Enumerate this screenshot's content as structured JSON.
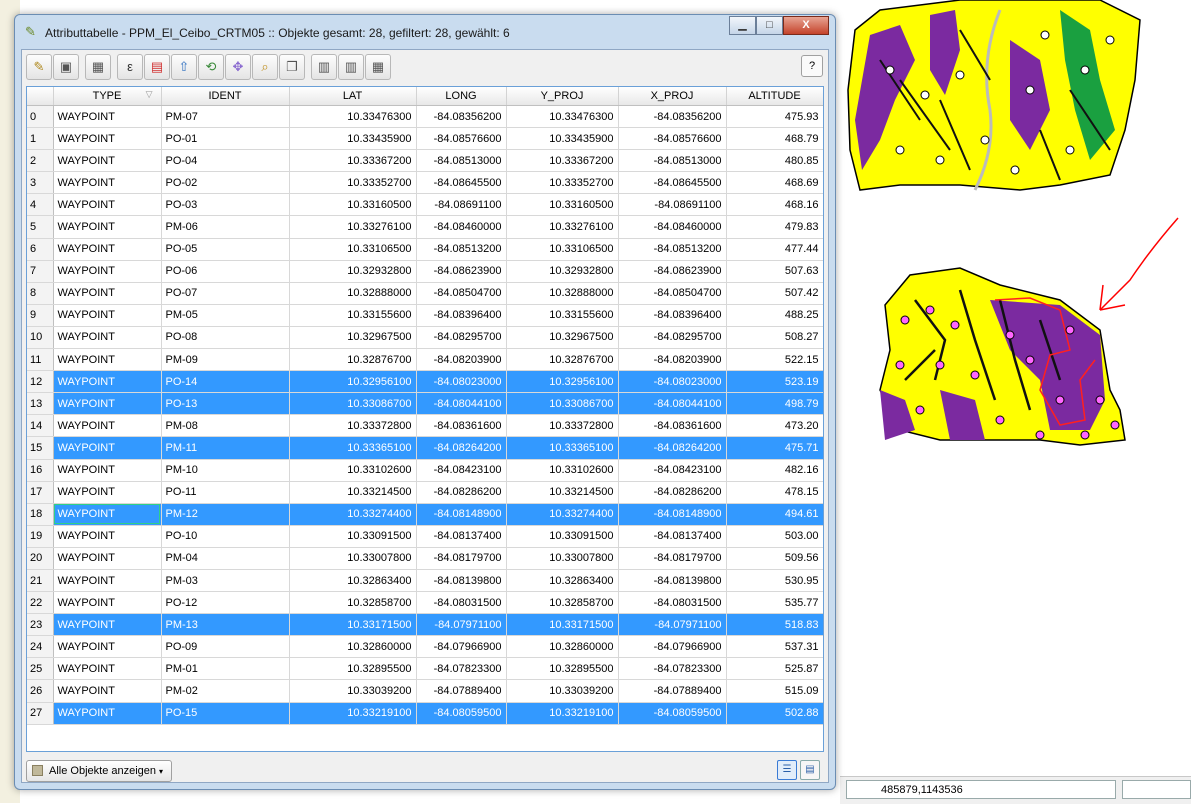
{
  "window": {
    "title": "Attributtabelle - PPM_El_Ceibo_CRTM05 :: Objekte gesamt: 28, gefiltert: 28, gewählt: 6",
    "minimize": "▁",
    "maximize": "□",
    "close": "X"
  },
  "toolbar": {
    "help_label": "?",
    "icons": [
      "pencil-icon",
      "save-icon",
      "delete-icon",
      "expression-select-icon",
      "deselect-icon",
      "move-to-top-icon",
      "invert-selection-icon",
      "pan-to-selection-icon",
      "zoom-to-selection-icon",
      "copy-icon",
      "new-column-icon",
      "delete-column-icon",
      "field-calculator-icon"
    ]
  },
  "table": {
    "columns": [
      "TYPE",
      "IDENT",
      "LAT",
      "LONG",
      "Y_PROJ",
      "X_PROJ",
      "ALTITUDE"
    ],
    "selected_rows": [
      12,
      13,
      15,
      18,
      23,
      27
    ],
    "rows": [
      [
        "0",
        "WAYPOINT",
        "PM-07",
        "10.33476300",
        "-84.08356200",
        "10.33476300",
        "-84.08356200",
        "475.93"
      ],
      [
        "1",
        "WAYPOINT",
        "PO-01",
        "10.33435900",
        "-84.08576600",
        "10.33435900",
        "-84.08576600",
        "468.79"
      ],
      [
        "2",
        "WAYPOINT",
        "PO-04",
        "10.33367200",
        "-84.08513000",
        "10.33367200",
        "-84.08513000",
        "480.85"
      ],
      [
        "3",
        "WAYPOINT",
        "PO-02",
        "10.33352700",
        "-84.08645500",
        "10.33352700",
        "-84.08645500",
        "468.69"
      ],
      [
        "4",
        "WAYPOINT",
        "PO-03",
        "10.33160500",
        "-84.08691100",
        "10.33160500",
        "-84.08691100",
        "468.16"
      ],
      [
        "5",
        "WAYPOINT",
        "PM-06",
        "10.33276100",
        "-84.08460000",
        "10.33276100",
        "-84.08460000",
        "479.83"
      ],
      [
        "6",
        "WAYPOINT",
        "PO-05",
        "10.33106500",
        "-84.08513200",
        "10.33106500",
        "-84.08513200",
        "477.44"
      ],
      [
        "7",
        "WAYPOINT",
        "PO-06",
        "10.32932800",
        "-84.08623900",
        "10.32932800",
        "-84.08623900",
        "507.63"
      ],
      [
        "8",
        "WAYPOINT",
        "PO-07",
        "10.32888000",
        "-84.08504700",
        "10.32888000",
        "-84.08504700",
        "507.42"
      ],
      [
        "9",
        "WAYPOINT",
        "PM-05",
        "10.33155600",
        "-84.08396400",
        "10.33155600",
        "-84.08396400",
        "488.25"
      ],
      [
        "10",
        "WAYPOINT",
        "PO-08",
        "10.32967500",
        "-84.08295700",
        "10.32967500",
        "-84.08295700",
        "508.27"
      ],
      [
        "11",
        "WAYPOINT",
        "PM-09",
        "10.32876700",
        "-84.08203900",
        "10.32876700",
        "-84.08203900",
        "522.15"
      ],
      [
        "12",
        "WAYPOINT",
        "PO-14",
        "10.32956100",
        "-84.08023000",
        "10.32956100",
        "-84.08023000",
        "523.19"
      ],
      [
        "13",
        "WAYPOINT",
        "PO-13",
        "10.33086700",
        "-84.08044100",
        "10.33086700",
        "-84.08044100",
        "498.79"
      ],
      [
        "14",
        "WAYPOINT",
        "PM-08",
        "10.33372800",
        "-84.08361600",
        "10.33372800",
        "-84.08361600",
        "473.20"
      ],
      [
        "15",
        "WAYPOINT",
        "PM-11",
        "10.33365100",
        "-84.08264200",
        "10.33365100",
        "-84.08264200",
        "475.71"
      ],
      [
        "16",
        "WAYPOINT",
        "PM-10",
        "10.33102600",
        "-84.08423100",
        "10.33102600",
        "-84.08423100",
        "482.16"
      ],
      [
        "17",
        "WAYPOINT",
        "PO-11",
        "10.33214500",
        "-84.08286200",
        "10.33214500",
        "-84.08286200",
        "478.15"
      ],
      [
        "18",
        "WAYPOINT",
        "PM-12",
        "10.33274400",
        "-84.08148900",
        "10.33274400",
        "-84.08148900",
        "494.61"
      ],
      [
        "19",
        "WAYPOINT",
        "PO-10",
        "10.33091500",
        "-84.08137400",
        "10.33091500",
        "-84.08137400",
        "503.00"
      ],
      [
        "20",
        "WAYPOINT",
        "PM-04",
        "10.33007800",
        "-84.08179700",
        "10.33007800",
        "-84.08179700",
        "509.56"
      ],
      [
        "21",
        "WAYPOINT",
        "PM-03",
        "10.32863400",
        "-84.08139800",
        "10.32863400",
        "-84.08139800",
        "530.95"
      ],
      [
        "22",
        "WAYPOINT",
        "PO-12",
        "10.32858700",
        "-84.08031500",
        "10.32858700",
        "-84.08031500",
        "535.77"
      ],
      [
        "23",
        "WAYPOINT",
        "PM-13",
        "10.33171500",
        "-84.07971100",
        "10.33171500",
        "-84.07971100",
        "518.83"
      ],
      [
        "24",
        "WAYPOINT",
        "PO-09",
        "10.32860000",
        "-84.07966900",
        "10.32860000",
        "-84.07966900",
        "537.31"
      ],
      [
        "25",
        "WAYPOINT",
        "PM-01",
        "10.32895500",
        "-84.07823300",
        "10.32895500",
        "-84.07823300",
        "525.87"
      ],
      [
        "26",
        "WAYPOINT",
        "PM-02",
        "10.33039200",
        "-84.07889400",
        "10.33039200",
        "-84.07889400",
        "515.09"
      ],
      [
        "27",
        "WAYPOINT",
        "PO-15",
        "10.33219100",
        "-84.08059500",
        "10.33219100",
        "-84.08059500",
        "502.88"
      ]
    ]
  },
  "footer": {
    "show_all_label": "Alle Objekte anzeigen"
  },
  "statusbar": {
    "coordinates": "485879,1143536"
  },
  "colors": {
    "selection": "#3399ff",
    "map_yellow": "#ffff00",
    "map_purple": "#7b2aa0",
    "map_green": "#1aa040",
    "annotation_red": "#ff0000"
  }
}
